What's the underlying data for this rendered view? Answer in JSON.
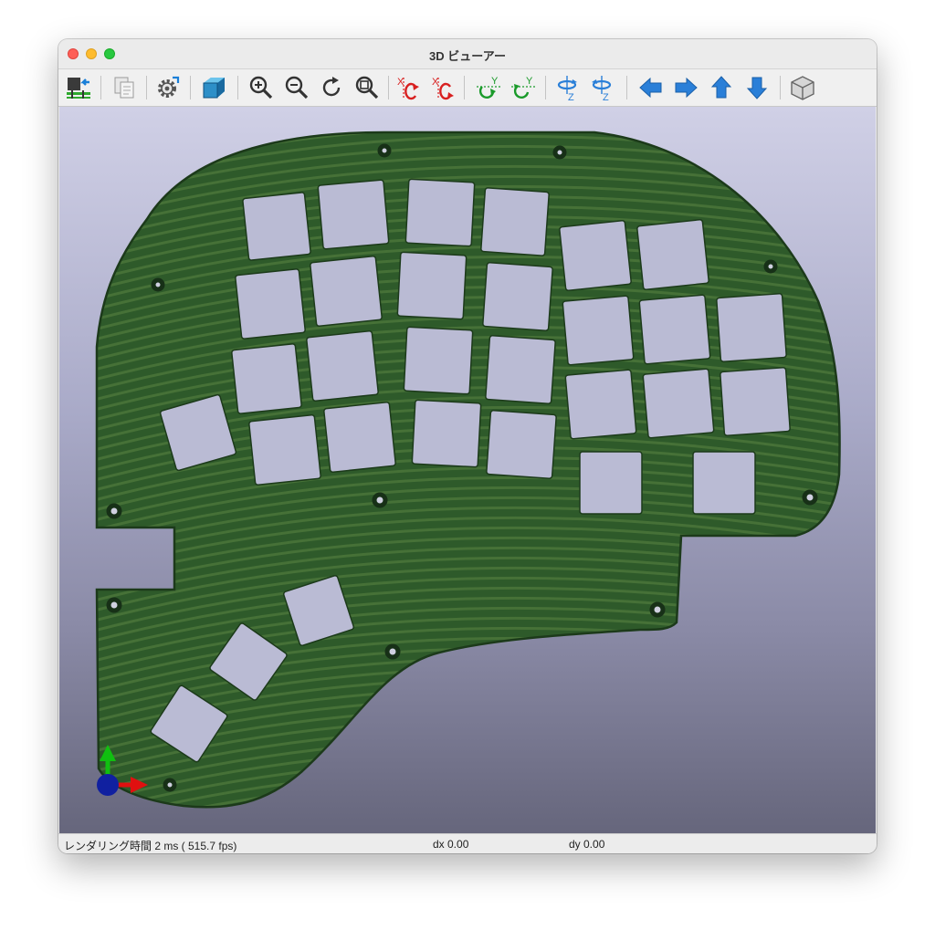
{
  "window": {
    "title": "3D ビューアー"
  },
  "toolbar": {
    "buttons": [
      {
        "name": "reload-board-button",
        "icon": "reload-board-icon"
      },
      {
        "name": "copy-image-button",
        "icon": "copy-icon"
      },
      {
        "name": "settings-button",
        "icon": "gear-icon"
      },
      {
        "name": "raytracing-button",
        "icon": "cube-icon"
      },
      {
        "name": "zoom-in-button",
        "icon": "zoom-in-icon"
      },
      {
        "name": "zoom-out-button",
        "icon": "zoom-out-icon"
      },
      {
        "name": "refresh-button",
        "icon": "refresh-icon"
      },
      {
        "name": "zoom-fit-button",
        "icon": "zoom-fit-icon"
      },
      {
        "name": "rotate-x-cw-button",
        "icon": "rotate-x-icon",
        "glyph": "X"
      },
      {
        "name": "rotate-x-ccw-button",
        "icon": "rotate-x-icon",
        "glyph": "X"
      },
      {
        "name": "rotate-y-cw-button",
        "icon": "rotate-y-icon",
        "glyph": "Y"
      },
      {
        "name": "rotate-y-ccw-button",
        "icon": "rotate-y-icon",
        "glyph": "Y"
      },
      {
        "name": "rotate-z-cw-button",
        "icon": "rotate-z-icon",
        "glyph": "Z"
      },
      {
        "name": "rotate-z-ccw-button",
        "icon": "rotate-z-icon",
        "glyph": "Z"
      },
      {
        "name": "move-left-button",
        "icon": "arrow-left-icon"
      },
      {
        "name": "move-right-button",
        "icon": "arrow-right-icon"
      },
      {
        "name": "move-up-button",
        "icon": "arrow-up-icon"
      },
      {
        "name": "move-down-button",
        "icon": "arrow-down-icon"
      },
      {
        "name": "orthographic-toggle-button",
        "icon": "wireframe-cube-icon"
      }
    ]
  },
  "status": {
    "render_time": "レンダリング時間 2 ms ( 515.7 fps)",
    "dx": "dx 0.00",
    "dy": "dy 0.00"
  },
  "colors": {
    "board": "#2e5a2a",
    "board_stripe": "#4f7a3c",
    "board_edge": "#1c3a1a",
    "cutout": "#babbd4",
    "axis_x": "#e01010",
    "axis_y": "#10c010",
    "axis_z": "#1020a0",
    "icon_blue": "#2a7fd8",
    "icon_red": "#d82020",
    "icon_green": "#1a9a2a"
  }
}
